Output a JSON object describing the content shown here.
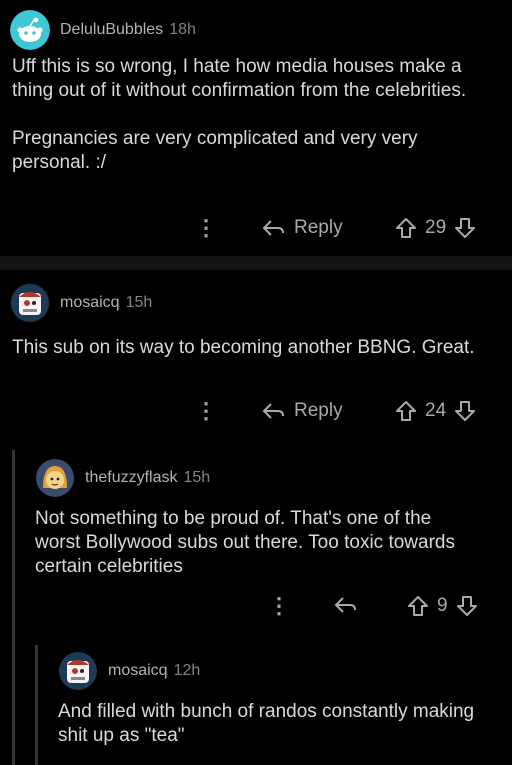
{
  "comments": [
    {
      "username": "DeluluBubbles",
      "age": "18h",
      "body": "Uff this is so wrong, I hate how media houses make a thing out of it without confirmation from the celebrities.\n\nPregnancies are very complicated and very very personal. :/",
      "reply_label": "Reply",
      "score": "29"
    },
    {
      "username": "mosaicq",
      "age": "15h",
      "body": "This sub on its way to becoming another BBNG. Great.",
      "reply_label": "Reply",
      "score": "24"
    },
    {
      "username": "thefuzzyflask",
      "age": "15h",
      "body": "Not something to be proud of. That's one of the worst Bollywood subs out there. Too toxic towards certain celebrities",
      "score": "9"
    },
    {
      "username": "mosaicq",
      "age": "12h",
      "body": "And filled with bunch of randos constantly making shit up as \"tea\""
    }
  ],
  "colors": {
    "background": "#000000",
    "text": "#d7dadc",
    "muted": "#818384",
    "avatar_default": "#3ec8d6"
  },
  "icons": [
    "reddit-avatar-icon",
    "more-options-icon",
    "reply-arrow-icon",
    "upvote-icon",
    "downvote-icon"
  ]
}
